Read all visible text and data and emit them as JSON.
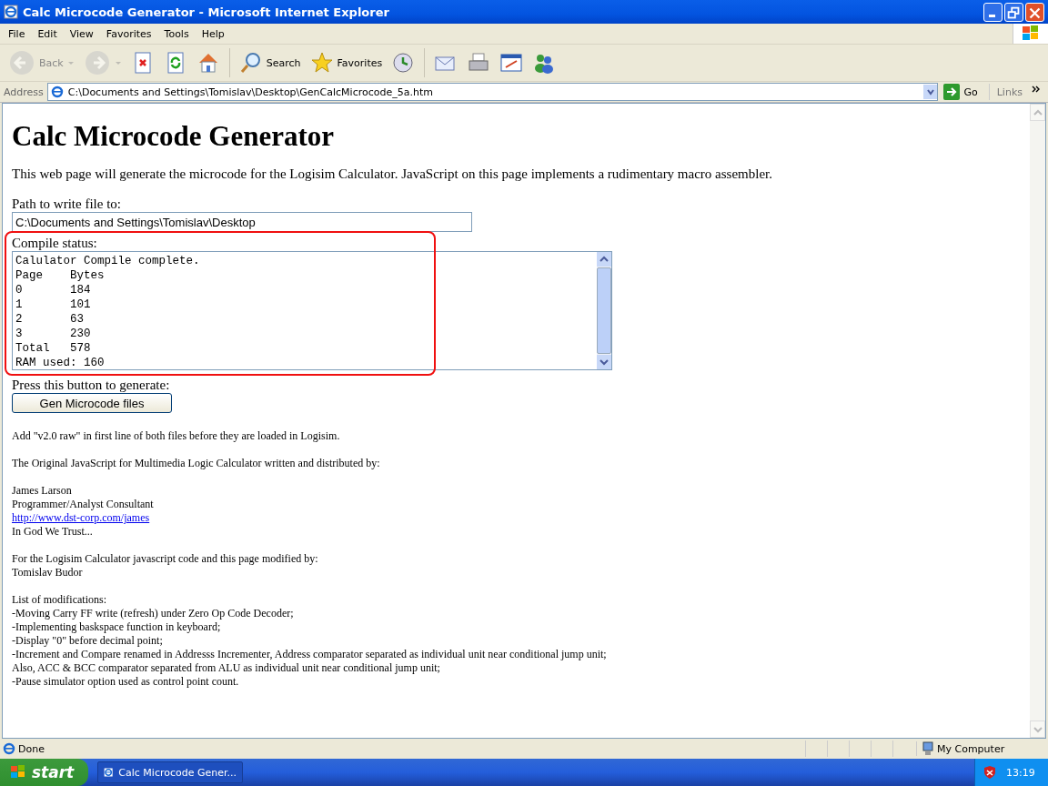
{
  "window": {
    "title": "Calc Microcode Generator - Microsoft Internet Explorer"
  },
  "menu": [
    "File",
    "Edit",
    "View",
    "Favorites",
    "Tools",
    "Help"
  ],
  "toolbar": [
    {
      "kind": "back",
      "label": "Back",
      "disabled": true
    },
    {
      "kind": "forward",
      "disabled": true
    },
    {
      "kind": "stop",
      "disabled": false
    },
    {
      "kind": "refresh",
      "disabled": false
    },
    {
      "kind": "home",
      "disabled": false
    },
    {
      "kind": "search",
      "label": "Search",
      "disabled": false
    },
    {
      "kind": "favorites",
      "label": "Favorites",
      "disabled": false
    },
    {
      "kind": "history",
      "disabled": false
    },
    {
      "kind": "mail",
      "disabled": false
    },
    {
      "kind": "print",
      "disabled": false
    },
    {
      "kind": "edit",
      "disabled": false
    },
    {
      "kind": "messenger",
      "disabled": false
    }
  ],
  "address_bar": {
    "label": "Address",
    "value": "C:\\Documents and Settings\\Tomislav\\Desktop\\GenCalcMicrocode_5a.htm",
    "go": "Go",
    "links": "Links"
  },
  "page": {
    "heading": "Calc Microcode Generator",
    "intro": "This web page will generate the microcode for the Logisim Calculator. JavaScript on this page implements a rudimentary macro assembler.",
    "path_label": "Path to write file to:",
    "path_value": "C:\\Documents and Settings\\Tomislav\\Desktop",
    "status_label": "Compile status:",
    "status_lines": [
      "Calulator Compile complete.",
      "Page    Bytes",
      "0       184",
      "1       101",
      "2       63",
      "3       230",
      "Total   578",
      "RAM used: 160"
    ],
    "button_label": "Press this button to generate:",
    "button": "Gen Microcode files",
    "notes": [
      [
        {
          "kind": "text",
          "text": "Add \"v2.0 raw\" in first line of both files before they are loaded in Logisim."
        }
      ],
      [
        {
          "kind": "text",
          "text": "The Original JavaScript for Multimedia Logic Calculator written and distributed by:"
        }
      ],
      [
        {
          "kind": "text",
          "text": "James Larson"
        },
        {
          "kind": "text",
          "text": "Programmer/Analyst Consultant"
        },
        {
          "kind": "link",
          "text": "http://www.dst-corp.com/james"
        },
        {
          "kind": "text",
          "text": "In God We Trust..."
        }
      ],
      [
        {
          "kind": "text",
          "text": "For the Logisim Calculator javascript code and this page modified by:"
        },
        {
          "kind": "text",
          "text": "Tomislav Budor"
        }
      ],
      [
        {
          "kind": "text",
          "text": "List of modifications:"
        },
        {
          "kind": "text",
          "text": "-Moving Carry FF write (refresh) under Zero Op Code Decoder;"
        },
        {
          "kind": "text",
          "text": "-Implementing baskspace function in keyboard;"
        },
        {
          "kind": "text",
          "text": "-Display \"0\" before decimal point;"
        },
        {
          "kind": "text",
          "text": "-Increment and Compare renamed in Addresss Incrementer, Address comparator separated as individual unit near conditional jump unit;"
        },
        {
          "kind": "text",
          "text": "Also, ACC & BCC comparator separated from ALU as individual unit near conditional jump unit;"
        },
        {
          "kind": "text",
          "text": "-Pause simulator option used as control point count."
        }
      ]
    ]
  },
  "status_bar": {
    "text": "Done",
    "zone": "My Computer"
  },
  "taskbar": {
    "start": "start",
    "task": "Calc Microcode Gener...",
    "clock": "13:19"
  }
}
